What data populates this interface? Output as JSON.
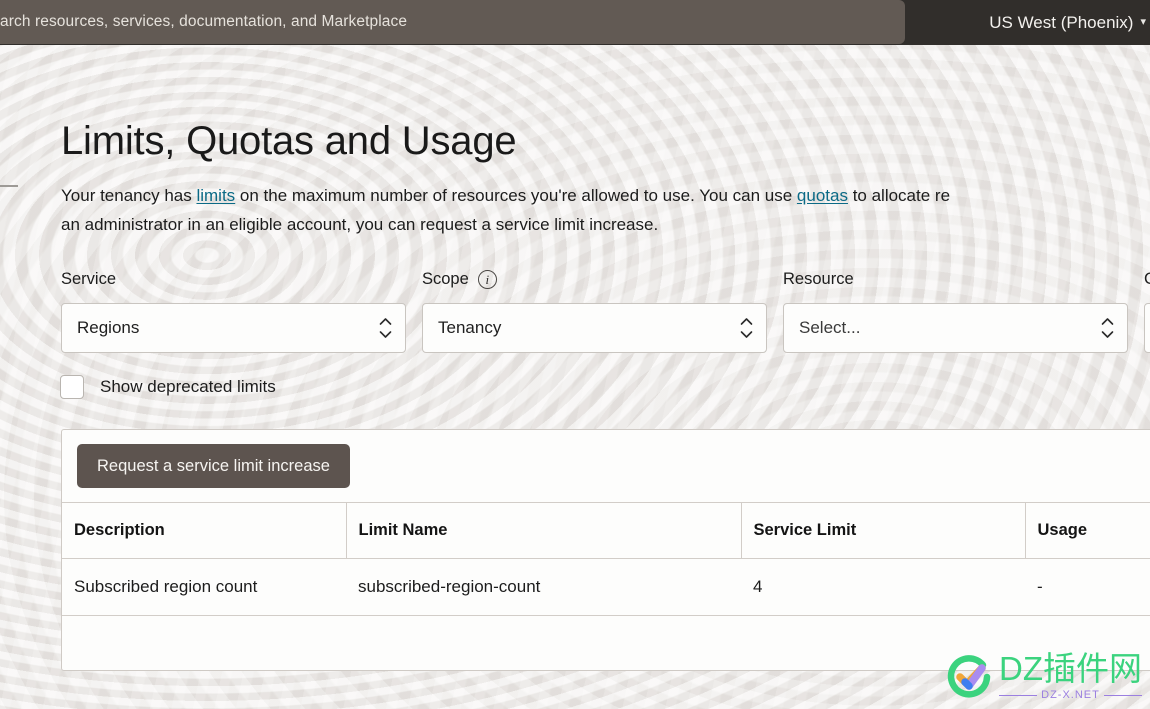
{
  "topbar": {
    "search_placeholder": "arch resources, services, documentation, and Marketplace",
    "region_label": "US West (Phoenix)",
    "region_caret": "▾",
    "bar_color": "#312e2b",
    "search_color": "#625a54"
  },
  "page": {
    "title": "Limits, Quotas and Usage",
    "intro_part1": "Your tenancy has ",
    "intro_link1": "limits",
    "intro_part2": " on the maximum number of resources you're allowed to use. You can use ",
    "intro_link2": "quotas",
    "intro_part3": " to allocate re",
    "intro_line2": "an administrator in an eligible account, you can request a service limit increase.",
    "link_color": "#0b6a86"
  },
  "filters": [
    {
      "label": "Service",
      "value": "Regions",
      "has_info": false
    },
    {
      "label": "Scope",
      "value": "Tenancy",
      "has_info": true
    },
    {
      "label": "Resource",
      "value": "Select...",
      "has_info": false
    },
    {
      "label": "C",
      "value": "",
      "has_info": false
    }
  ],
  "checkbox": {
    "label": "Show deprecated limits",
    "checked": false
  },
  "table": {
    "button_label": "Request a service limit increase",
    "button_color": "#5d544f",
    "headers": [
      "Description",
      "Limit Name",
      "Service Limit",
      "Usage"
    ],
    "rows": [
      {
        "description": "Subscribed region count",
        "limit_name": "subscribed-region-count",
        "service_limit": "4",
        "usage": "-"
      }
    ]
  },
  "watermark": {
    "brand": "DZ插件网",
    "subtitle": "DZ-X.NET",
    "brand_color": "#3bd37e",
    "subtitle_color": "#9b7fe0"
  }
}
